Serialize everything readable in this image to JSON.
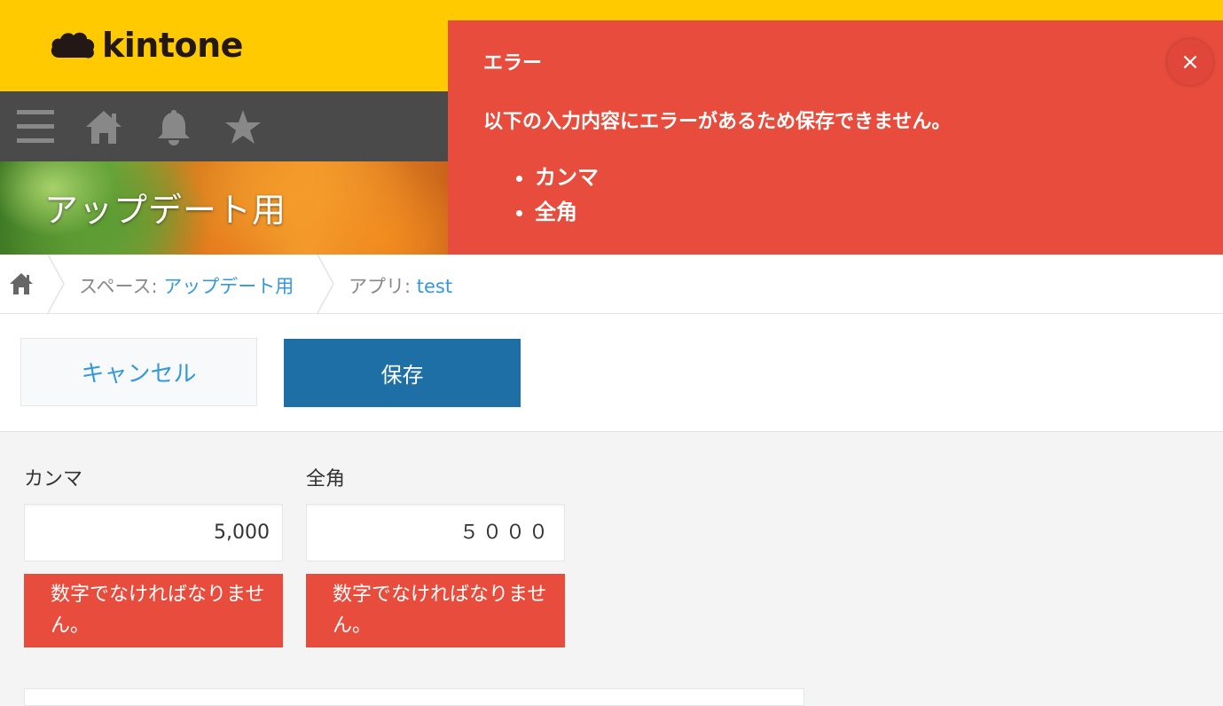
{
  "header": {
    "logo_text": "kintone",
    "nav": [
      "menu-icon",
      "home-icon",
      "bell-icon",
      "star-icon"
    ]
  },
  "banner": {
    "title": "アップデート用"
  },
  "notification": {
    "title": "エラー",
    "message": "以下の入力内容にエラーがあるため保存できません。",
    "items": [
      "カンマ",
      "全角"
    ],
    "close_label": "×"
  },
  "breadcrumb": {
    "space_prefix": "スペース: ",
    "space_name": "アップデート用",
    "app_prefix": "アプリ: ",
    "app_name": "test"
  },
  "actions": {
    "cancel_label": "キャンセル",
    "save_label": "保存"
  },
  "fields": [
    {
      "label": "カンマ",
      "value": "5,000",
      "error": "数字でなければなりません。"
    },
    {
      "label": "全角",
      "value": "５０００",
      "error": "数字でなければなりません。"
    }
  ],
  "colors": {
    "brand_yellow": "#ffcb00",
    "error_red": "#e74c3c",
    "primary_blue": "#1d6fa5",
    "link_blue": "#3498db"
  }
}
